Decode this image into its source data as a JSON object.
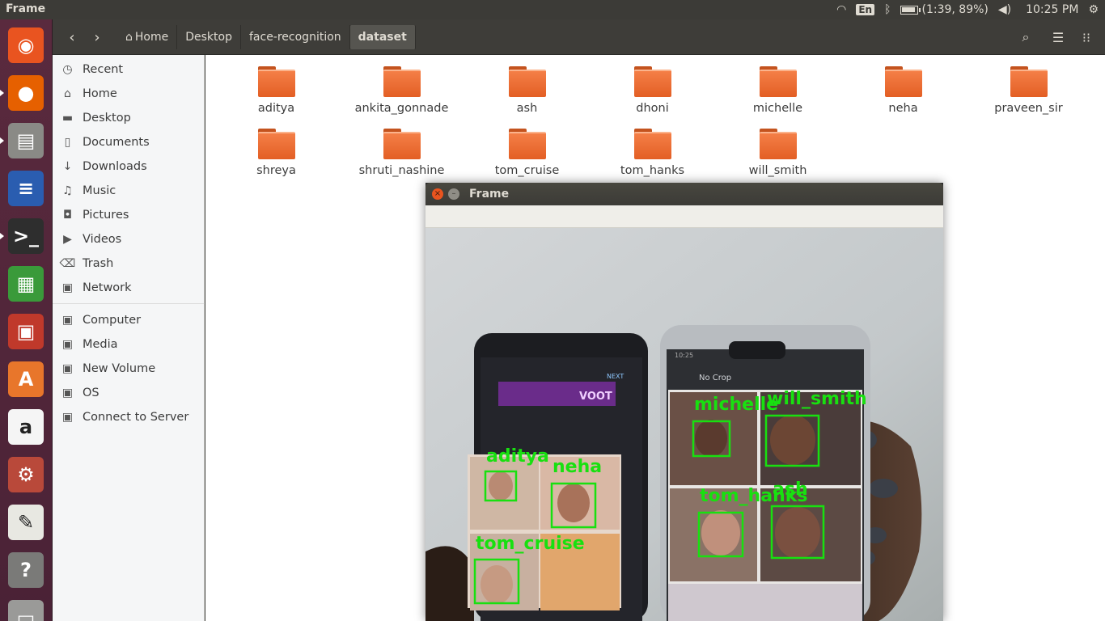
{
  "top_panel": {
    "app_title": "Frame",
    "keyboard_layout": "En",
    "battery_text": "(1:39, 89%)",
    "battery_percent": 89,
    "clock": "10:25 PM"
  },
  "launcher": {
    "items": [
      {
        "name": "ubuntu-dash",
        "glyph": "◉",
        "color": "#e95420"
      },
      {
        "name": "firefox",
        "glyph": "●",
        "color": "#e66000"
      },
      {
        "name": "files",
        "glyph": "▤",
        "color": "#8a8a86"
      },
      {
        "name": "writer",
        "glyph": "≡",
        "color": "#2a5db0"
      },
      {
        "name": "terminal",
        "glyph": ">_",
        "color": "#2e2e2e"
      },
      {
        "name": "calc",
        "glyph": "▦",
        "color": "#3a9a3a"
      },
      {
        "name": "impress",
        "glyph": "▣",
        "color": "#c0392b"
      },
      {
        "name": "software",
        "glyph": "A",
        "color": "#e8762b"
      },
      {
        "name": "amazon",
        "glyph": "a",
        "color": "#f5f5f5"
      },
      {
        "name": "settings",
        "glyph": "⚙",
        "color": "#b9493a"
      },
      {
        "name": "text-editor",
        "glyph": "✎",
        "color": "#e8e8e2"
      },
      {
        "name": "help",
        "glyph": "?",
        "color": "#7a7a78"
      },
      {
        "name": "drive",
        "glyph": "▭",
        "color": "#9a9a98"
      }
    ]
  },
  "toolbar": {
    "back_glyph": "‹",
    "forward_glyph": "›",
    "path": [
      {
        "label": "Home",
        "has_icon": true
      },
      {
        "label": "Desktop"
      },
      {
        "label": "face-recognition"
      },
      {
        "label": "dataset",
        "active": true
      }
    ]
  },
  "sidebar": {
    "items": [
      {
        "label": "Recent",
        "icon": "clock-icon",
        "glyph": "◷"
      },
      {
        "label": "Home",
        "icon": "home-icon",
        "glyph": "⌂"
      },
      {
        "label": "Desktop",
        "icon": "desktop-icon",
        "glyph": "▬"
      },
      {
        "label": "Documents",
        "icon": "documents-icon",
        "glyph": "▯"
      },
      {
        "label": "Downloads",
        "icon": "downloads-icon",
        "glyph": "↓"
      },
      {
        "label": "Music",
        "icon": "music-icon",
        "glyph": "♫"
      },
      {
        "label": "Pictures",
        "icon": "pictures-icon",
        "glyph": "◘"
      },
      {
        "label": "Videos",
        "icon": "videos-icon",
        "glyph": "▶"
      },
      {
        "label": "Trash",
        "icon": "trash-icon",
        "glyph": "⌫"
      },
      {
        "label": "Network",
        "icon": "network-icon",
        "glyph": "▣"
      }
    ],
    "devices": [
      {
        "label": "Computer",
        "icon": "computer-icon",
        "glyph": "▣"
      },
      {
        "label": "Media",
        "icon": "drive-icon",
        "glyph": "▣"
      },
      {
        "label": "New Volume",
        "icon": "drive-icon",
        "glyph": "▣"
      },
      {
        "label": "OS",
        "icon": "drive-icon",
        "glyph": "▣"
      },
      {
        "label": "Connect to Server",
        "icon": "server-icon",
        "glyph": "▣"
      }
    ]
  },
  "folders": [
    "aditya",
    "ankita_gonnade",
    "ash",
    "dhoni",
    "michelle",
    "neha",
    "praveen_sir",
    "shreya",
    "shruti_nashine",
    "tom_cruise",
    "tom_hanks",
    "will_smith"
  ],
  "frame_window": {
    "title": "Frame",
    "close_glyph": "×",
    "minimize_glyph": "–",
    "detections": [
      {
        "name": "aditya"
      },
      {
        "name": "neha"
      },
      {
        "name": "tom_cruise"
      },
      {
        "name": "michelle"
      },
      {
        "name": "will_smith"
      },
      {
        "name": "tom_hanks"
      },
      {
        "name": "ash"
      }
    ],
    "phone_left": {
      "header": "VOOT",
      "next": "NEXT"
    },
    "phone_right": {
      "header": "No Crop",
      "status": "10:25"
    }
  },
  "colors": {
    "accent": "#e95420",
    "folder": "#ed6a2f",
    "detection": "#18e010"
  }
}
